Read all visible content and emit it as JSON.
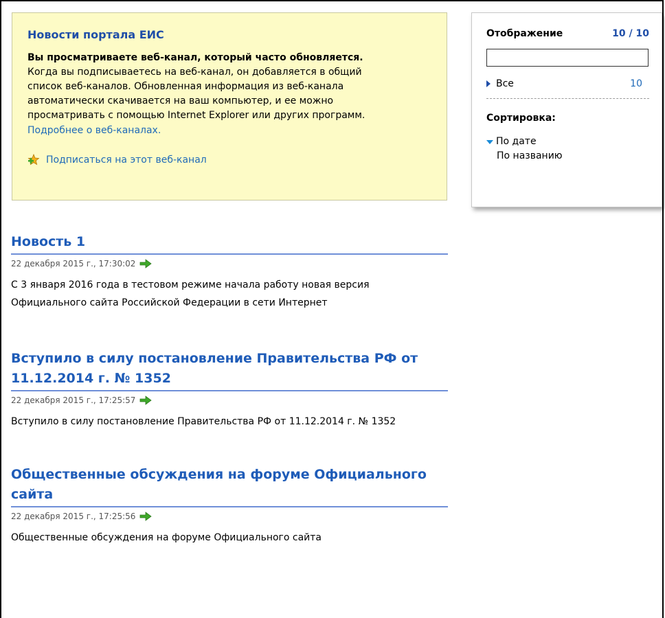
{
  "feed": {
    "title": "Новости портала ЕИС",
    "intro_bold": "Вы просматриваете веб-канал, который часто обновляется.",
    "intro_line1": "Когда вы подписываетесь на веб-канал, он добавляется в общий",
    "intro_line2": "список веб-каналов. Обновленная информация из веб-канала",
    "intro_line3": "автоматически скачивается на ваш компьютер, и ее можно",
    "intro_line4": "просматривать с помощью Internet Explorer или других программ.",
    "learn_more_link": "Подробнее о веб-каналах.",
    "subscribe_link": "Подписаться на этот веб-канал"
  },
  "side": {
    "display_label": "Отображение",
    "display_count": "10 / 10",
    "search_value": "",
    "filter_all_label": "Все",
    "filter_all_count": "10",
    "sort_label": "Сортировка:",
    "sort_by_date": "По дате",
    "sort_by_name": "По названию"
  },
  "news": [
    {
      "title_line1": "Новость 1",
      "title_line2": "",
      "date": "22 декабря 2015 г., 17:30:02",
      "body_line1": "С 3 января 2016 года в тестовом режиме начала работу новая версия",
      "body_line2": "Официального сайта Российской Федерации в сети Интернет"
    },
    {
      "title_line1": "Вступило в силу постановление Правительства РФ от",
      "title_line2": "11.12.2014 г. № 1352",
      "date": "22 декабря 2015 г., 17:25:57",
      "body_line1": "Вступило в силу постановление Правительства РФ от 11.12.2014 г. № 1352",
      "body_line2": ""
    },
    {
      "title_line1": "Общественные обсуждения на форуме Официального",
      "title_line2": "сайта",
      "date": "22 декабря 2015 г., 17:25:56",
      "body_line1": "Общественные обсуждения на форуме Официального сайта",
      "body_line2": ""
    }
  ],
  "colors": {
    "feed_background": "#fdfbc6",
    "title_blue": "#1f5cb8",
    "link_blue": "#1f6ab8",
    "arrow_green": "#3fa82a"
  },
  "icons": {
    "subscribe": "add-feed-icon",
    "go": "green-arrow-icon",
    "expand": "triangle-right-icon",
    "sorted": "triangle-down-icon"
  }
}
